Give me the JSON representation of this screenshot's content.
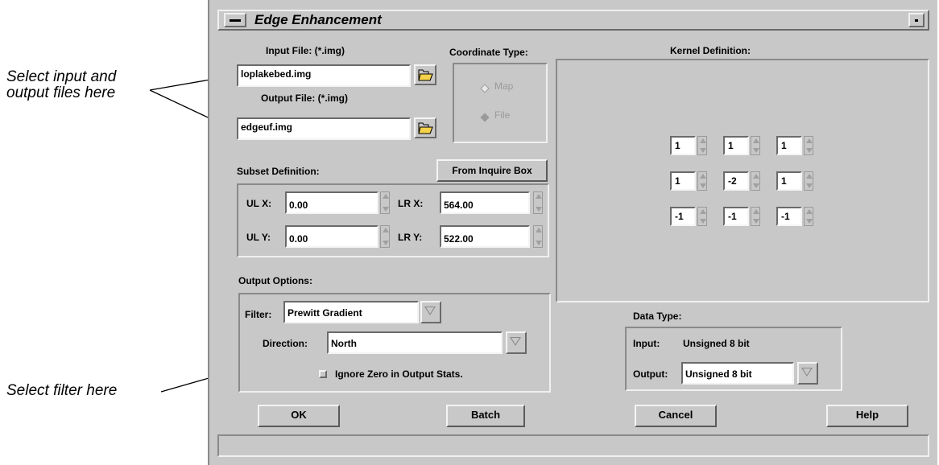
{
  "callouts": {
    "input_output": "Select input and\noutput files here",
    "filter": "Select filter here"
  },
  "window": {
    "title": "Edge Enhancement"
  },
  "files": {
    "input_label": "Input File: (*.img)",
    "input_value": "loplakebed.img",
    "output_label": "Output File: (*.img)",
    "output_value": "edgeuf.img"
  },
  "coordinate": {
    "label": "Coordinate Type:",
    "options": [
      "Map",
      "File"
    ],
    "selected": "File"
  },
  "subset": {
    "label": "Subset Definition:",
    "inquire_button": "From Inquire Box",
    "ulx_label": "UL X:",
    "ulx_value": "0.00",
    "lrx_label": "LR X:",
    "lrx_value": "564.00",
    "uly_label": "UL Y:",
    "uly_value": "0.00",
    "lry_label": "LR Y:",
    "lry_value": "522.00"
  },
  "kernel": {
    "label": "Kernel Definition:",
    "rows": [
      [
        "1",
        "1",
        "1"
      ],
      [
        "1",
        "-2",
        "1"
      ],
      [
        "-1",
        "-1",
        "-1"
      ]
    ]
  },
  "output_options": {
    "label": "Output Options:",
    "filter_label": "Filter:",
    "filter_value": "Prewitt Gradient",
    "direction_label": "Direction:",
    "direction_value": "North",
    "ignore_zero_label": "Ignore Zero in Output Stats.",
    "ignore_zero_checked": false
  },
  "data_type": {
    "label": "Data Type:",
    "input_label": "Input:",
    "input_value": "Unsigned 8 bit",
    "output_label": "Output:",
    "output_value": "Unsigned 8 bit"
  },
  "buttons": {
    "ok": "OK",
    "batch": "Batch",
    "cancel": "Cancel",
    "help": "Help"
  },
  "status_bar": ""
}
